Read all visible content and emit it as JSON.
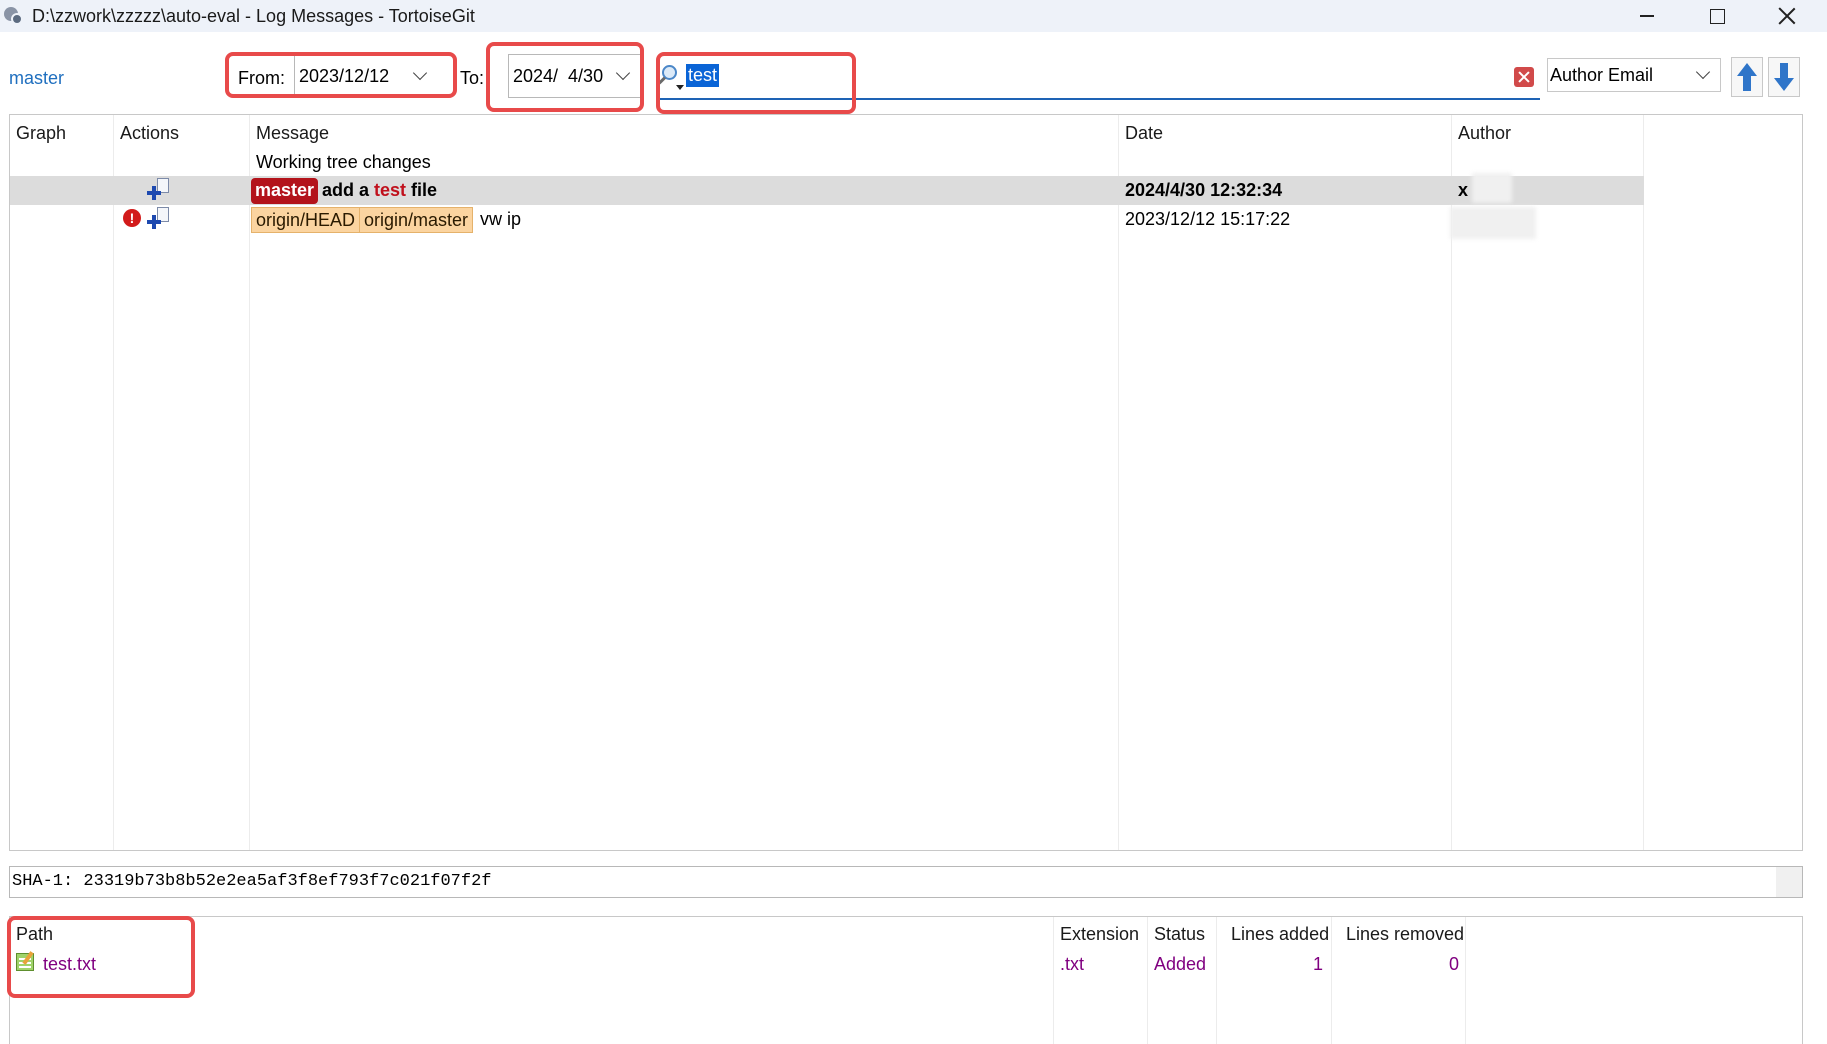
{
  "window": {
    "title": "D:\\zzwork\\zzzzz\\auto-eval - Log Messages - TortoiseGit"
  },
  "toolbar": {
    "branch": "master",
    "from_label": "From:",
    "from_date": "2023/12/12",
    "to_label": "To:",
    "to_date": "2024/  4/30",
    "search_text": "test",
    "filter_field": "Author Email"
  },
  "log": {
    "columns": [
      "Graph",
      "Actions",
      "Message",
      "Date",
      "Author"
    ],
    "working_tree": "Working tree changes",
    "rows": [
      {
        "refs": [
          "master"
        ],
        "message_pre": "add a ",
        "message_match": "test",
        "message_post": " file",
        "date": "2024/4/30 12:32:34",
        "author": "x"
      },
      {
        "refs": [
          "origin/HEAD",
          "origin/master"
        ],
        "message": "vw ip",
        "date": "2023/12/12 15:17:22",
        "author": ""
      }
    ]
  },
  "sha": "SHA-1: 23319b73b8b52e2ea5af3f8ef793f7c021f07f2f",
  "files": {
    "columns": [
      "Path",
      "Extension",
      "Status",
      "Lines added",
      "Lines removed"
    ],
    "rows": [
      {
        "path": "test.txt",
        "extension": ".txt",
        "status": "Added",
        "lines_added": "1",
        "lines_removed": "0"
      }
    ]
  },
  "colors": {
    "accent": "#1e63b5",
    "highlight_box": "#e84a4a",
    "master_tag": "#b3131b",
    "remote_tag": "#fbd4a0",
    "file_text": "#800080"
  },
  "icons": {
    "app": "tortoisegit-icon",
    "search": "search-icon",
    "clear": "clear-icon",
    "up": "arrow-up-icon",
    "down": "arrow-down-icon",
    "commit": "commit-add-icon",
    "warning": "warning-icon",
    "file": "text-file-icon"
  }
}
